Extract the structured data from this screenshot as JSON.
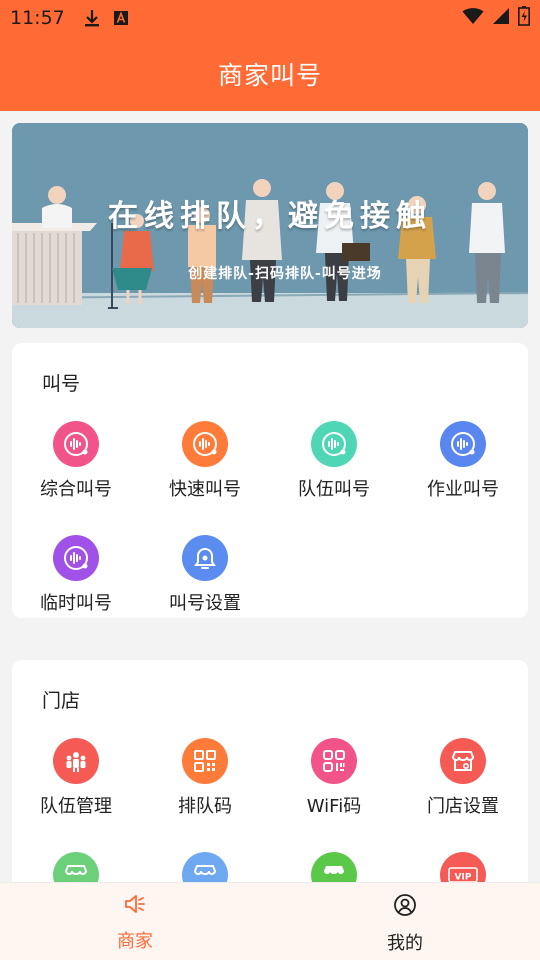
{
  "status": {
    "time": "11:57",
    "icons": [
      "download-icon",
      "a-box-icon",
      "wifi-icon",
      "signal-icon",
      "battery-icon"
    ]
  },
  "appbar": {
    "title": "商家叫号"
  },
  "banner": {
    "headline": "在线排队，避免接触",
    "subline": "创建排队-扫码排队-叫号进场"
  },
  "sections": [
    {
      "title": "叫号",
      "items": [
        {
          "label": "综合叫号",
          "icon": "voice-call-icon",
          "color": "#f2548a"
        },
        {
          "label": "快速叫号",
          "icon": "voice-call-icon",
          "color": "#ff7b3a"
        },
        {
          "label": "队伍叫号",
          "icon": "voice-call-icon",
          "color": "#4fd6b4"
        },
        {
          "label": "作业叫号",
          "icon": "voice-call-icon",
          "color": "#5a86f0"
        },
        {
          "label": "临时叫号",
          "icon": "voice-call-icon",
          "color": "#a052e8"
        },
        {
          "label": "叫号设置",
          "icon": "bell-settings-icon",
          "color": "#5b8cf0"
        }
      ]
    },
    {
      "title": "门店",
      "items": [
        {
          "label": "队伍管理",
          "icon": "team-icon",
          "color": "#f55a55"
        },
        {
          "label": "排队码",
          "icon": "qr-code-icon",
          "color": "#ff7b3a"
        },
        {
          "label": "WiFi码",
          "icon": "qr-code-icon",
          "color": "#f2548a"
        },
        {
          "label": "门店设置",
          "icon": "store-settings-icon",
          "color": "#f55a55"
        },
        {
          "label": "",
          "icon": "store-icon",
          "color": "#6ccf7a"
        },
        {
          "label": "",
          "icon": "store-icon",
          "color": "#6ea8f0"
        },
        {
          "label": "",
          "icon": "store-icon",
          "color": "#5cc84a"
        },
        {
          "label": "",
          "icon": "vip-icon",
          "color": "#f55a55",
          "badge": "VIP"
        }
      ]
    }
  ],
  "tabs": [
    {
      "label": "商家",
      "icon": "speaker-icon",
      "active": true,
      "color": "#ff6a35"
    },
    {
      "label": "我的",
      "icon": "user-icon",
      "active": false,
      "color": "#222222"
    }
  ]
}
